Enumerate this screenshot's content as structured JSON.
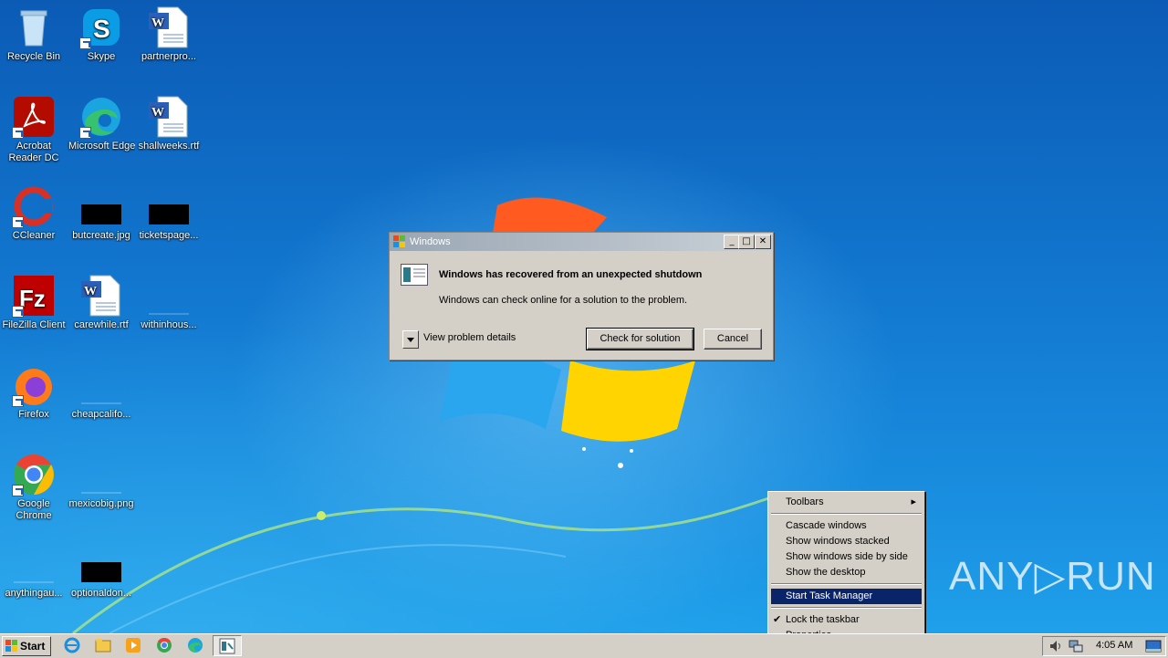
{
  "desktop": {
    "icons": [
      {
        "label": "Recycle Bin"
      },
      {
        "label": "Skype"
      },
      {
        "label": "partnerpro..."
      },
      {
        "label": "Acrobat Reader DC"
      },
      {
        "label": "Microsoft Edge"
      },
      {
        "label": "shallweeks.rtf"
      },
      {
        "label": "CCleaner"
      },
      {
        "label": "butcreate.jpg"
      },
      {
        "label": "ticketspage..."
      },
      {
        "label": "FileZilla Client"
      },
      {
        "label": "carewhile.rtf"
      },
      {
        "label": "withinhous..."
      },
      {
        "label": "Firefox"
      },
      {
        "label": "cheapcalifo..."
      },
      {
        "label": "Google Chrome"
      },
      {
        "label": "mexicobig.png"
      },
      {
        "label": "anythingau..."
      },
      {
        "label": "optionaldon..."
      }
    ]
  },
  "dialog": {
    "title": "Windows",
    "heading": "Windows has recovered from an unexpected shutdown",
    "message": "Windows can check online for a solution to the problem.",
    "details_label": "View problem details",
    "check_button": "Check for solution",
    "cancel_button": "Cancel"
  },
  "context_menu": {
    "items": [
      {
        "label": "Toolbars"
      },
      {
        "label": "Cascade windows"
      },
      {
        "label": "Show windows stacked"
      },
      {
        "label": "Show windows side by side"
      },
      {
        "label": "Show the desktop"
      },
      {
        "label": "Start Task Manager"
      },
      {
        "label": "Lock the taskbar"
      },
      {
        "label": "Properties"
      }
    ]
  },
  "taskbar": {
    "start_label": "Start",
    "clock": "4:05 AM"
  },
  "watermark": "ANY▷RUN",
  "colors": {
    "menu_highlight": "#0a246a",
    "dialog_bg": "#d4d0c8"
  }
}
